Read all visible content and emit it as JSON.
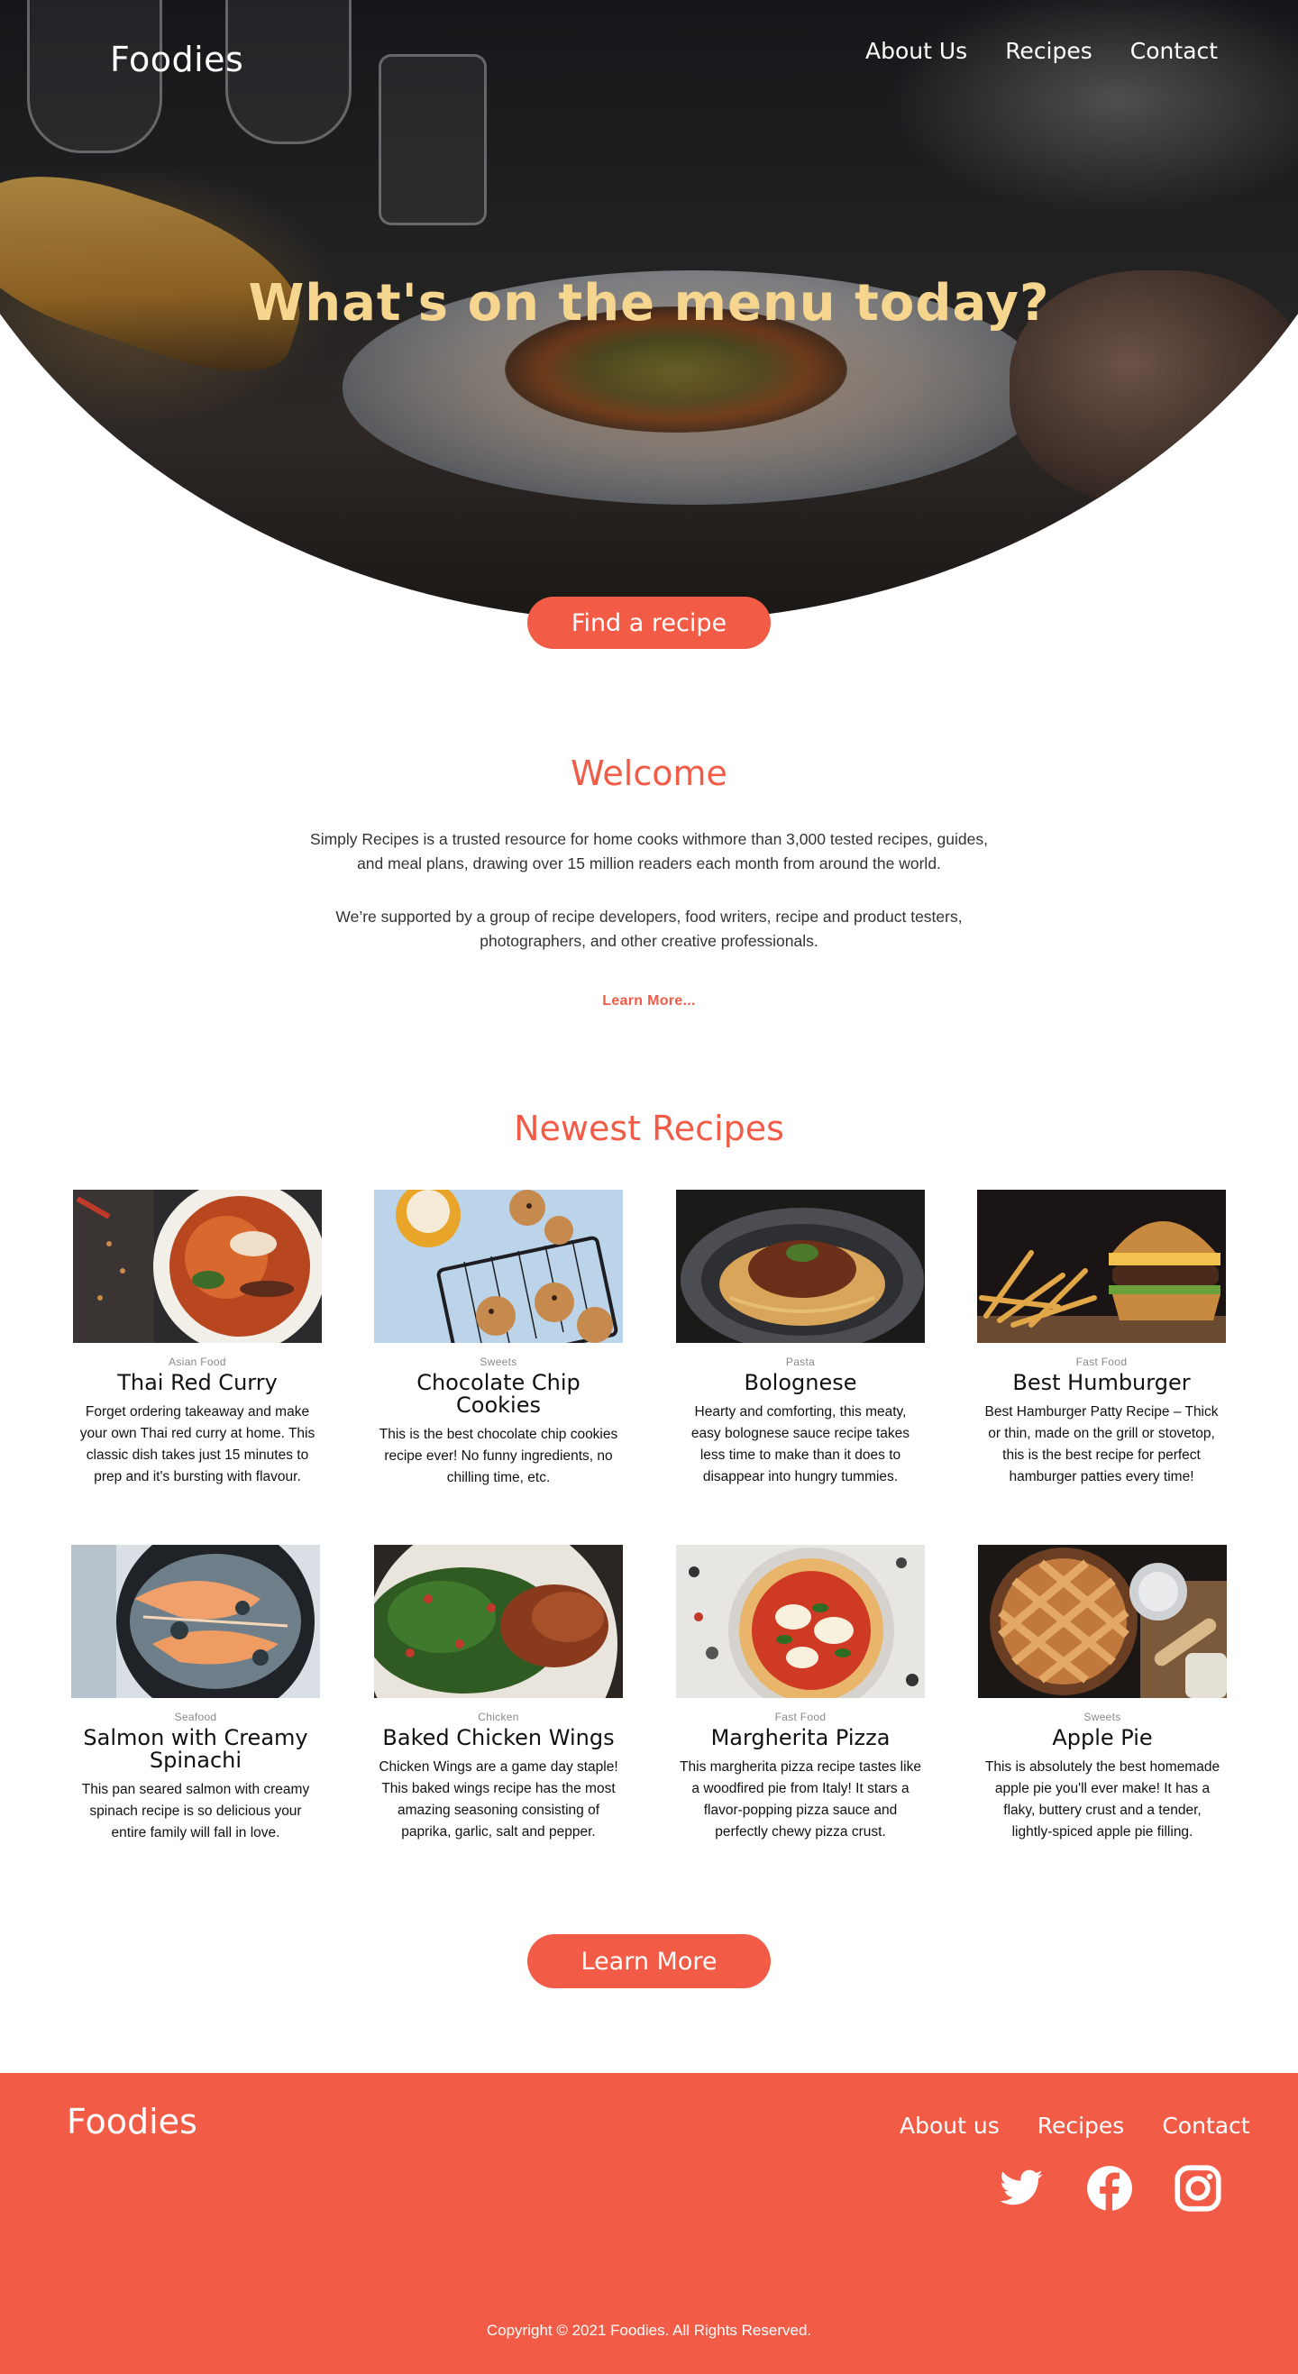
{
  "brand": {
    "name": "Foodies",
    "accent": "#f25c47",
    "hero_title_color": "#f6d58f"
  },
  "nav": {
    "links": [
      "About Us",
      "Recipes",
      "Contact"
    ]
  },
  "hero": {
    "title": "What's on the menu today?",
    "cta": "Find a recipe"
  },
  "welcome": {
    "title": "Welcome",
    "paragraph1": "Simply Recipes is a trusted resource for home cooks withmore than 3,000 tested recipes, guides, and meal plans, drawing over 15 million readers each month from around the world.",
    "paragraph2": "We’re supported by a group of recipe developers, food writers, recipe and product testers, photographers, and other creative professionals.",
    "link": "Learn More..."
  },
  "recipes": {
    "title": "Newest Recipes",
    "items": [
      {
        "category": "Asian Food",
        "title": "Thai Red Curry",
        "description": "Forget ordering takeaway and make your own Thai red curry at home. This classic dish takes just 15 minutes to prep and it's bursting with flavour."
      },
      {
        "category": "Sweets",
        "title": "Chocolate Chip Cookies",
        "description": "This is the best chocolate chip cookies recipe ever! No funny ingredients, no chilling time, etc."
      },
      {
        "category": "Pasta",
        "title": "Bolognese",
        "description": "Hearty and comforting, this meaty, easy bolognese sauce recipe takes less time to make than it does to disappear into hungry tummies."
      },
      {
        "category": "Fast Food",
        "title": "Best Humburger",
        "description": "Best Hamburger Patty Recipe – Thick or thin, made on the grill or stovetop, this is the best recipe for perfect hamburger patties every time!"
      },
      {
        "category": "Seafood",
        "title": "Salmon with Creamy Spinachi",
        "description": "This pan seared salmon with creamy spinach recipe is so delicious your entire family will fall in love."
      },
      {
        "category": "Chicken",
        "title": "Baked Chicken Wings",
        "description": "Chicken Wings are a game day staple! This baked wings recipe has the most amazing seasoning consisting of paprika, garlic, salt and pepper."
      },
      {
        "category": "Fast Food",
        "title": "Margherita Pizza",
        "description": "This margherita pizza recipe tastes like a woodfired pie from Italy! It stars a flavor-popping pizza sauce and perfectly chewy pizza crust."
      },
      {
        "category": "Sweets",
        "title": "Apple Pie",
        "description": "This is absolutely the best homemade apple pie you'll ever make! It has a flaky, buttery crust and a tender, lightly-spiced apple pie filling."
      }
    ],
    "button": "Learn More"
  },
  "footer": {
    "logo": "Foodies",
    "links": [
      "About us",
      "Recipes",
      "Contact"
    ],
    "social": [
      "twitter-icon",
      "facebook-icon",
      "instagram-icon"
    ],
    "copyright": "Copyright © 2021 Foodies. All Rights Reserved."
  }
}
